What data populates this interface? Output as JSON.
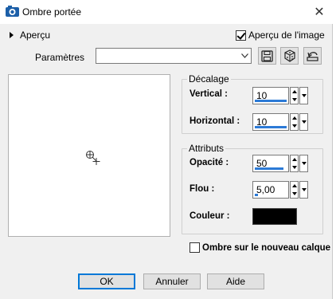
{
  "window": {
    "title": "Ombre portée",
    "close_symbol": "✕"
  },
  "apercu": {
    "toggle_label": "Aperçu",
    "checkbox_label": "Aperçu de l'image",
    "checkbox_checked": true
  },
  "presets": {
    "label": "Paramètres",
    "value": ""
  },
  "decalage": {
    "group_title": "Décalage",
    "vertical_label": "Vertical :",
    "vertical_value": "10",
    "horizontal_label": "Horizontal :",
    "horizontal_value": "10"
  },
  "attributs": {
    "group_title": "Attributs",
    "opacite_label": "Opacité :",
    "opacite_value": "50",
    "flou_label": "Flou :",
    "flou_value": "5,00",
    "couleur_label": "Couleur :",
    "couleur_value": "#000000"
  },
  "new_layer": {
    "label": "Ombre sur le nouveau calque",
    "checked": false
  },
  "buttons": {
    "ok": "OK",
    "cancel": "Annuler",
    "help": "Aide"
  },
  "colors": {
    "accent": "#2c7ad6",
    "focus_border": "#0078d7"
  }
}
